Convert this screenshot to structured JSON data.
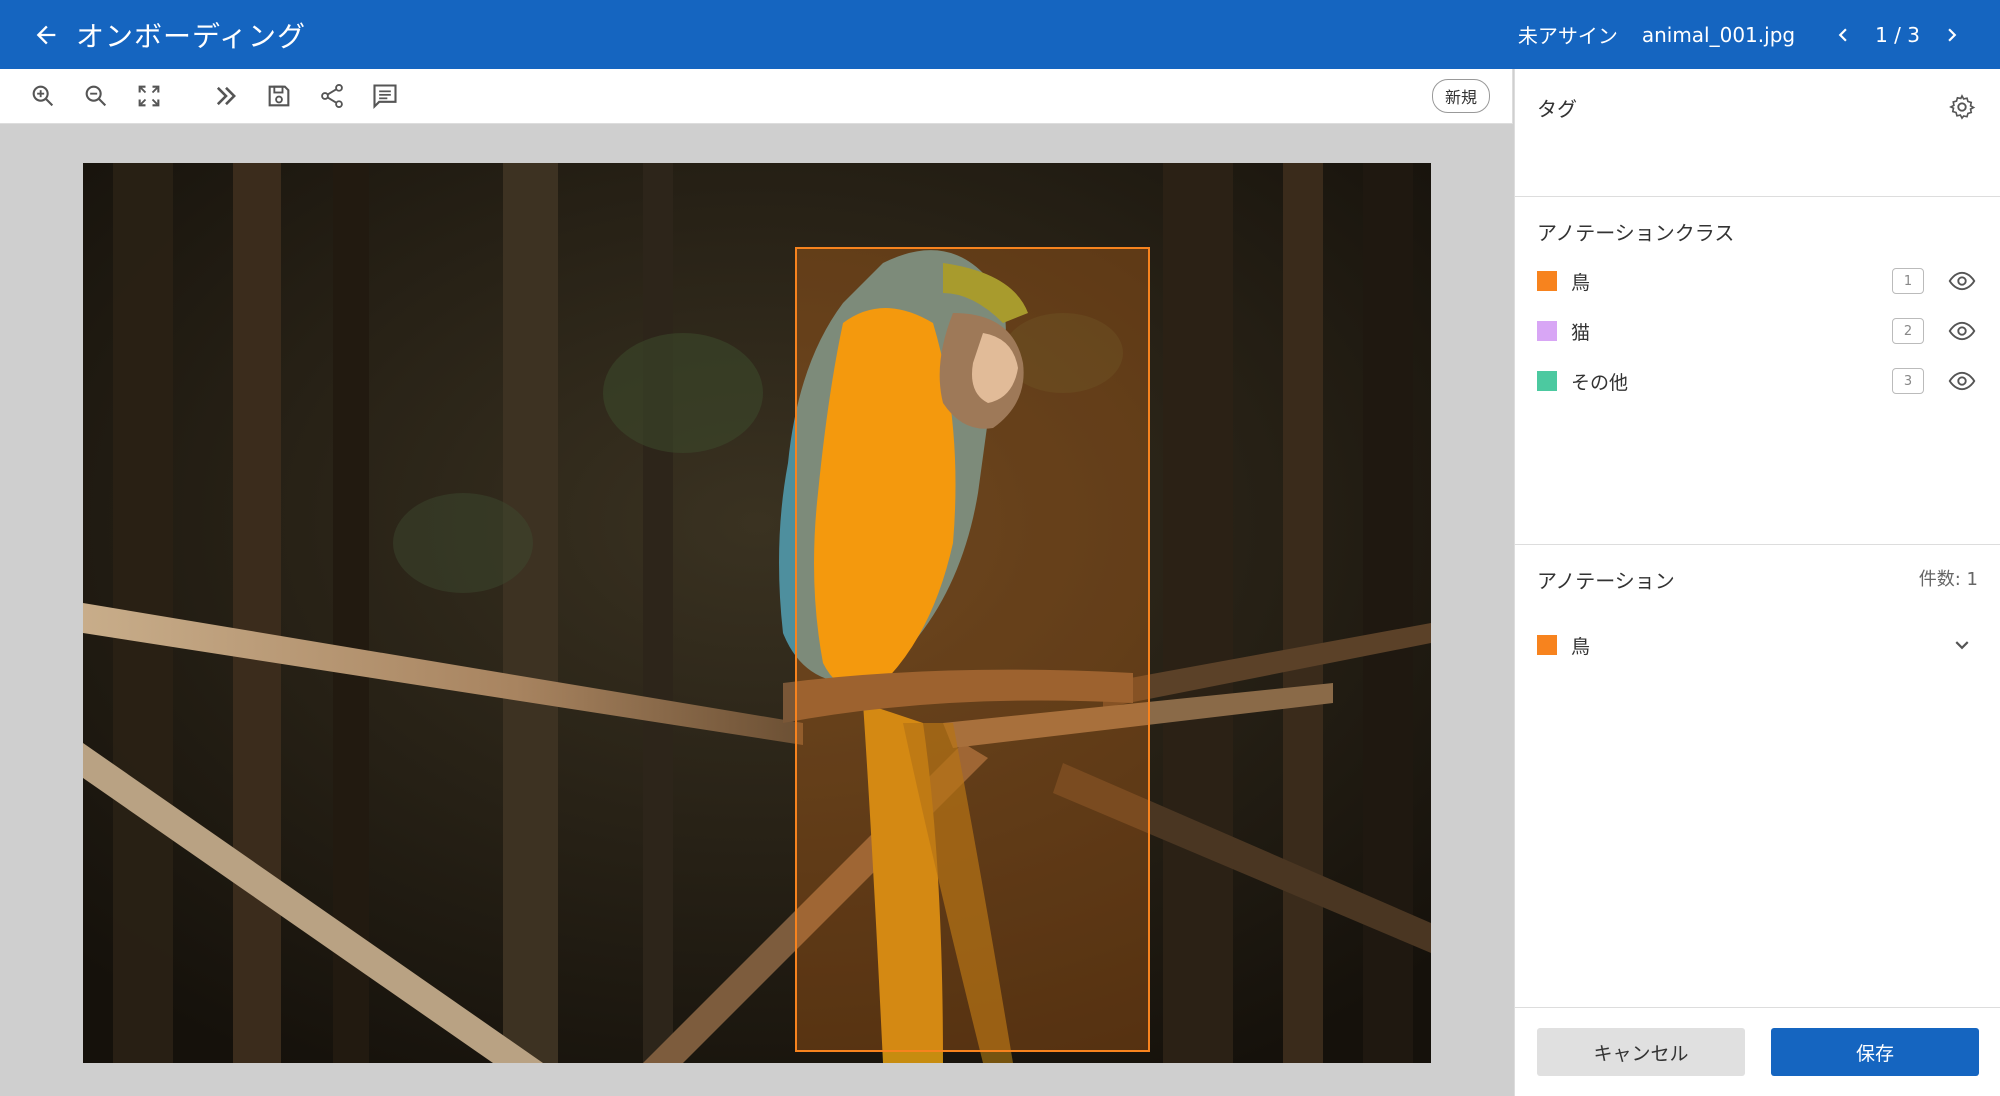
{
  "header": {
    "title": "オンボーディング",
    "assignee": "未アサイン",
    "filename": "animal_001.jpg",
    "page_indicator": "1 / 3"
  },
  "toolbar": {
    "tools": [
      "zoom-in-icon",
      "zoom-out-icon",
      "fit-screen-icon",
      "skip-icon",
      "save-icon",
      "share-icon",
      "comment-icon"
    ],
    "status_badge": "新規"
  },
  "panel": {
    "tags_title": "タグ",
    "classes_title": "アノテーションクラス",
    "classes": [
      {
        "label": "鳥",
        "color": "#f7831e",
        "hotkey": "1"
      },
      {
        "label": "猫",
        "color": "#d8a6f5",
        "hotkey": "2"
      },
      {
        "label": "その他",
        "color": "#4cc9a0",
        "hotkey": "3"
      }
    ],
    "annotations_title": "アノテーション",
    "annotations_count": "件数: 1",
    "annotations": [
      {
        "label": "鳥",
        "color": "#f7831e"
      }
    ]
  },
  "footer": {
    "cancel_label": "キャンセル",
    "save_label": "保存"
  },
  "colors": {
    "primary": "#1565c0",
    "bbox": "#f7831e"
  }
}
